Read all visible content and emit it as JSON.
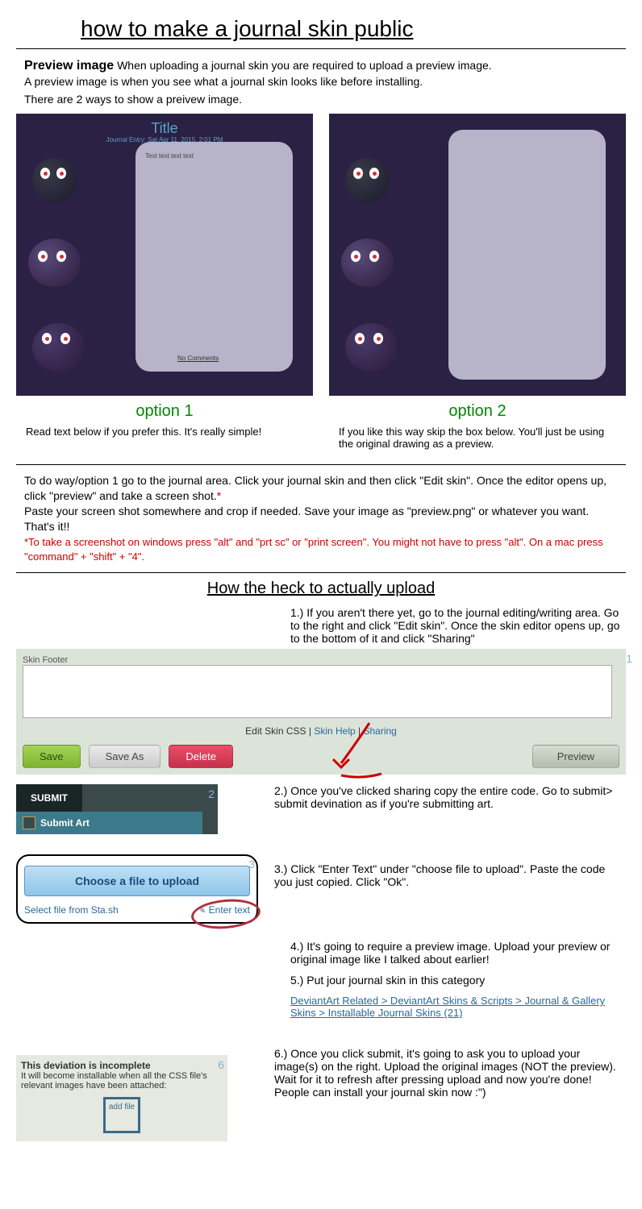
{
  "title": "how to make a journal skin public",
  "intro": {
    "label": "Preview image",
    "line1": "When uploading a journal skin you are required to upload a preview image.",
    "line2": "A preview image is when you see what a journal skin looks like before installing.",
    "line3": "There are 2 ways to show a preivew image."
  },
  "previews": {
    "titleText": "Title",
    "subText": "Journal Entry: Sat Apr 11, 2015, 2:01 PM",
    "bodyText": "Text text text text",
    "noComments": "No Comments",
    "option1": {
      "label": "option 1",
      "desc": "Read text below if you prefer this. It's really simple!"
    },
    "option2": {
      "label": "option 2",
      "desc": "If you like this way skip the box below. You'll just be using the original drawing as a preview."
    }
  },
  "howto": {
    "p1": "To do way/option 1 go to the journal area. Click your journal skin and then click \"Edit skin\". Once the editor opens up, click \"preview\" and take a screen shot.",
    "asterisk": "*",
    "p2": "Paste your screen shot somewhere and crop if needed. Save your image as \"preview.png\" or whatever you want. That's it!!",
    "note": "*To take a screenshot on windows press \"alt\" and \"prt sc\" or \"print screen\". You might not have to press \"alt\". On a mac press \"command\" + \"shift\" + \"4\"."
  },
  "subhead": "How the heck to actually upload",
  "steps": {
    "s1": "1.) If you aren't there yet, go to the journal editing/writing area. Go to the right and click \"Edit skin\". Once the skin editor opens up, go to the bottom of it and click \"Sharing\"",
    "s2": "2.) Once you've clicked sharing copy the entire code. Go to submit> submit devination as if you're submitting art.",
    "s3": "3.) Click \"Enter Text\" under \"choose file to upload\". Paste the code you just copied.  Click \"Ok\".",
    "s4": "4.) It's going to require a preview image. Upload your preview or original image like I talked about earlier!",
    "s5": "5.) Put jour journal skin in this category",
    "s6": "6.) Once you click submit, it's going to ask you to upload your image(s) on the right. Upload the original images (NOT the preview). Wait for it to refresh after pressing upload and now you're done! People can install your journal skin now :\")"
  },
  "editor": {
    "footer_label": "Skin Footer",
    "edit_css": "Edit Skin CSS",
    "skin_help": "Skin Help",
    "sharing": "Sharing",
    "save": "Save",
    "save_as": "Save As",
    "delete": "Delete",
    "preview": "Preview",
    "badge1": "1"
  },
  "submit": {
    "tab": "SUBMIT",
    "row": "Submit Art",
    "badge": "2"
  },
  "choose": {
    "btn": "Choose a file to upload",
    "stash": "Select file from Sta.sh",
    "enter": "Enter text",
    "badge": "3"
  },
  "category_link": "DeviantArt Related > DeviantArt Skins & Scripts > Journal & Gallery Skins > Installable Journal Skins (21)",
  "incomplete": {
    "title": "This deviation is incomplete",
    "body": "It will become installable when all the CSS file's relevant images have been attached:",
    "addfile": "add file",
    "badge": "6"
  }
}
